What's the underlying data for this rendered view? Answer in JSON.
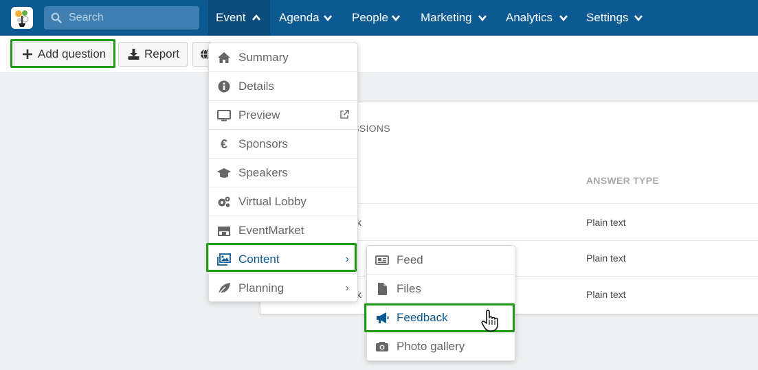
{
  "search": {
    "placeholder": "Search"
  },
  "nav": [
    {
      "label": "Event",
      "active": true
    },
    {
      "label": "Agenda"
    },
    {
      "label": "People"
    },
    {
      "label": "Marketing"
    },
    {
      "label": "Analytics"
    },
    {
      "label": "Settings"
    }
  ],
  "toolbar": {
    "add_question_label": "Add question",
    "report_label": "Report"
  },
  "card": {
    "section_title_fragment": "ISSIONS",
    "column_answer_type": "ANSWER TYPE",
    "rows": [
      {
        "fragment": "k",
        "answer_type": "Plain text"
      },
      {
        "fragment": "",
        "answer_type": "Plain text"
      },
      {
        "fragment": "k",
        "answer_type": "Plain text"
      }
    ]
  },
  "event_menu": [
    {
      "label": "Summary",
      "icon": "home-icon"
    },
    {
      "label": "Details",
      "icon": "info-icon"
    },
    {
      "label": "Preview",
      "icon": "monitor-icon"
    },
    {
      "label": "Sponsors",
      "icon": "euro-icon"
    },
    {
      "label": "Speakers",
      "icon": "graduation-cap-icon"
    },
    {
      "label": "Virtual Lobby",
      "icon": "gears-icon"
    },
    {
      "label": "EventMarket",
      "icon": "store-icon"
    },
    {
      "label": "Content",
      "icon": "images-icon",
      "selected": true
    },
    {
      "label": "Planning",
      "icon": "leaf-icon"
    }
  ],
  "content_submenu": [
    {
      "label": "Feed",
      "icon": "newspaper-icon"
    },
    {
      "label": "Files",
      "icon": "file-icon"
    },
    {
      "label": "Feedback",
      "icon": "megaphone-icon",
      "selected": true
    },
    {
      "label": "Photo gallery",
      "icon": "camera-icon"
    }
  ],
  "colors": {
    "nav_bg": "#0c5a91",
    "nav_active_bg": "#0b4c7c",
    "highlight": "#1e9a15",
    "selected_text": "#0c5a91"
  }
}
